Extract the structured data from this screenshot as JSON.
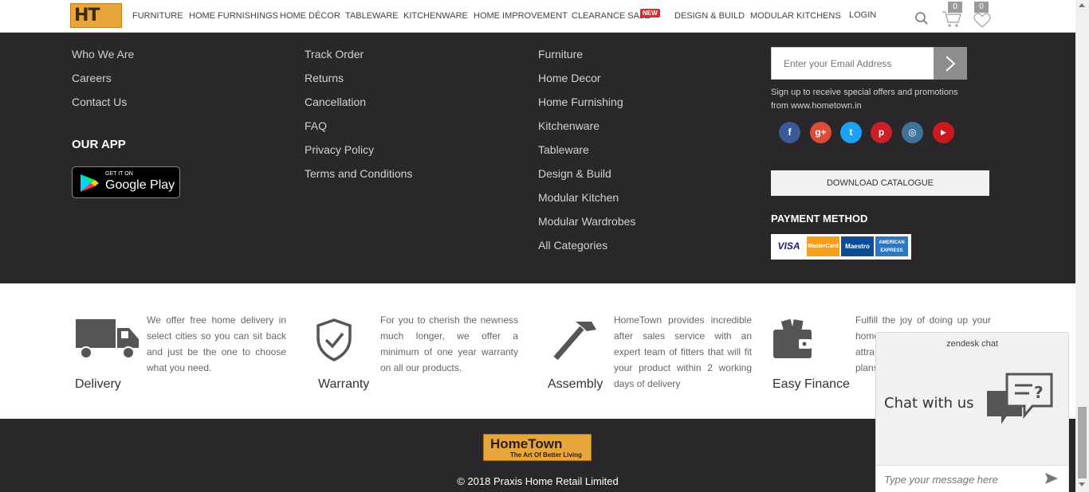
{
  "nav": {
    "items": [
      "FURNITURE",
      "HOME FURNISHINGS",
      "HOME DÉCOR",
      "TABLEWARE",
      "KITCHENWARE",
      "HOME IMPROVEMENT",
      "CLEARANCE SALE",
      "DESIGN & BUILD",
      "MODULAR KITCHENS"
    ],
    "new_badge": "NEW",
    "login": "LOGIN",
    "cart_count": "0",
    "wishlist_count": "0",
    "logo_text": "HT"
  },
  "footer": {
    "col1": [
      "Who We Are",
      "Careers",
      "Contact Us"
    ],
    "our_app": "OUR APP",
    "google_play_small": "GET IT ON",
    "google_play_big": "Google Play",
    "col2": [
      "Track Order",
      "Returns",
      "Cancellation",
      "FAQ",
      "Privacy Policy",
      "Terms and Conditions"
    ],
    "col3": [
      "Furniture",
      "Home Decor",
      "Home Furnishing",
      "Kitchenware",
      "Tableware",
      "Design & Build",
      "Modular Kitchen",
      "Modular Wardrobes",
      "All Categories"
    ],
    "email_placeholder": "Enter your Email Address",
    "signup_text": "Sign up to receive special offers and promotions from www.hometown.in",
    "download_catalogue": "DOWNLOAD CATALOGUE",
    "payment_method": "PAYMENT METHOD",
    "cards": [
      "VISA",
      "MasterCard",
      "Maestro",
      "AMERICAN EXPRESS"
    ],
    "social": [
      {
        "name": "facebook",
        "glyph": "f",
        "color": "#3b5998"
      },
      {
        "name": "google-plus",
        "glyph": "g+",
        "color": "#dd4b39"
      },
      {
        "name": "twitter",
        "glyph": "t",
        "color": "#1da1f2"
      },
      {
        "name": "pinterest",
        "glyph": "p",
        "color": "#cb2027"
      },
      {
        "name": "instagram",
        "glyph": "◎",
        "color": "#3f729b"
      },
      {
        "name": "youtube",
        "glyph": "▶",
        "color": "#cc181e"
      }
    ]
  },
  "services": [
    {
      "title": "Delivery",
      "text": "We offer free home delivery in select cities so you can sit back and just be the one to choose what you need.",
      "icon": "truck-icon"
    },
    {
      "title": "Warranty",
      "text": "For you to cherish the newness much longer, we offer a minimum of one year warranty on all our products.",
      "icon": "shield-check-icon"
    },
    {
      "title": "Assembly",
      "text": "HomeTown provides incredible after sales service with an expert team of fitters that will fit your product within 2 working days of delivery",
      "icon": "hammer-icon"
    },
    {
      "title": "Easy Finance",
      "text": "Fulfill the joy of doing up your home",
      "icon": "wallet-icon"
    }
  ],
  "services_partial": [
    "attra",
    "plans"
  ],
  "bottom": {
    "logo_brand": "HomeTown",
    "logo_tag": "The Art Of Better Living",
    "copyright": "© 2018 Praxis Home Retail Limited"
  },
  "chat": {
    "brand": "zendesk chat",
    "headline": "Chat with us",
    "placeholder": "Type your message here"
  },
  "colors": {
    "footer_bg": "#29272a",
    "accent": "#e8a63a",
    "badge_red": "#d32f2f"
  }
}
